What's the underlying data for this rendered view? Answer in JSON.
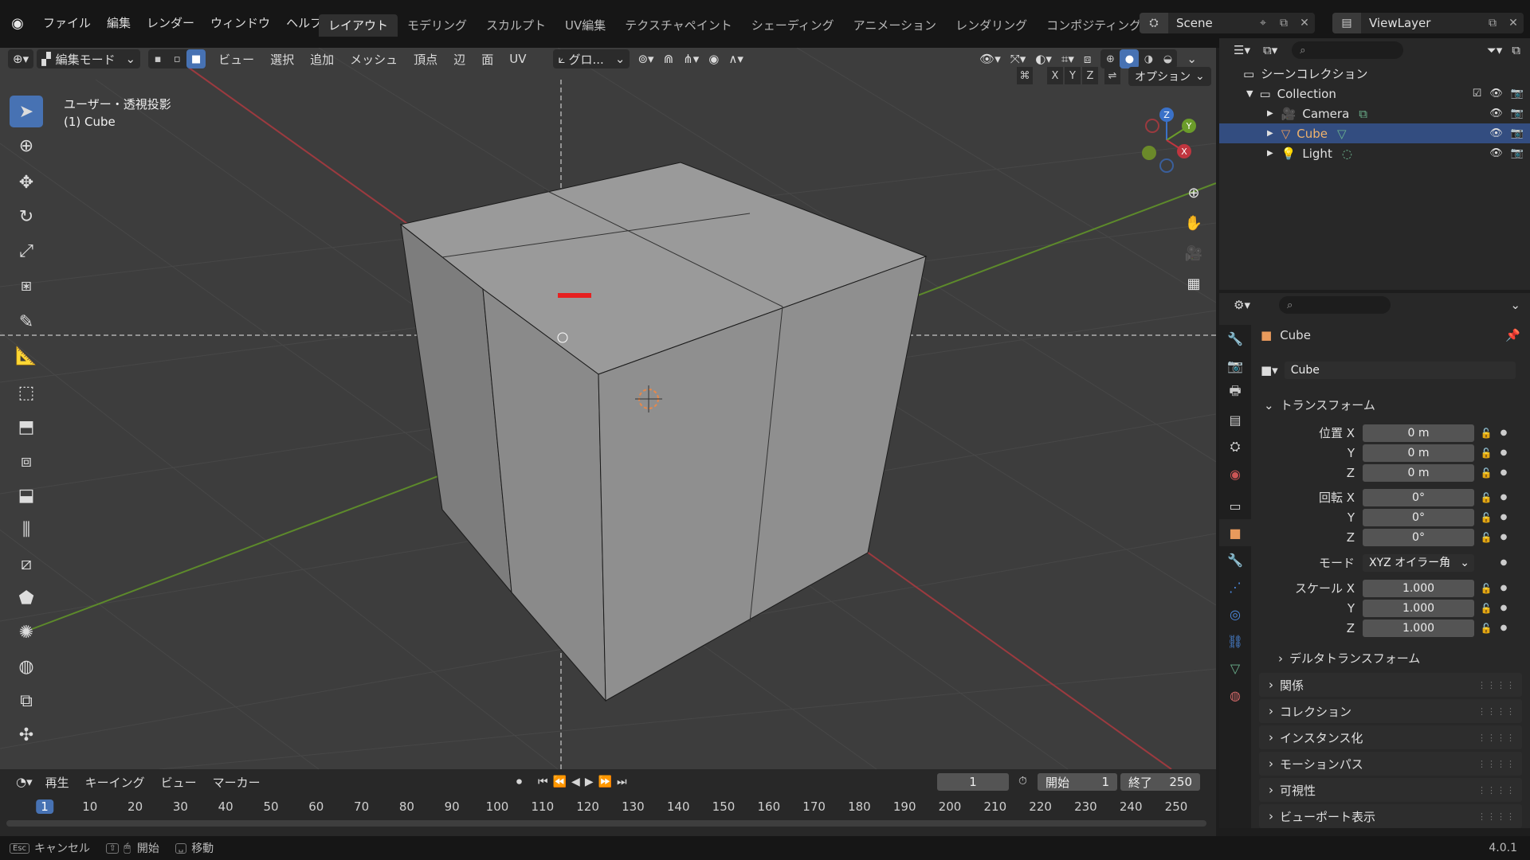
{
  "menu": {
    "items": [
      "ファイル",
      "編集",
      "レンダー",
      "ウィンドウ",
      "ヘルプ"
    ]
  },
  "workspace_tabs": [
    "レイアウト",
    "モデリング",
    "スカルプト",
    "UV編集",
    "テクスチャペイント",
    "シェーディング",
    "アニメーション",
    "レンダリング",
    "コンポジティング"
  ],
  "scene": {
    "name": "Scene"
  },
  "view_layer": {
    "name": "ViewLayer"
  },
  "viewport": {
    "mode": "編集モード",
    "menus": [
      "ビュー",
      "選択",
      "追加",
      "メッシュ",
      "頂点",
      "辺",
      "面",
      "UV"
    ],
    "orientation": "グロ...",
    "axes": [
      "X",
      "Y",
      "Z"
    ],
    "options_label": "オプション",
    "view_title": "ユーザー・透視投影",
    "object_label": "(1) Cube",
    "gizmo": {
      "x": "X",
      "y": "Y",
      "z": "Z"
    }
  },
  "outliner": {
    "root": "シーンコレクション",
    "collection": "Collection",
    "items": [
      {
        "name": "Camera",
        "icon": "camera-icon",
        "color": "#e89a5c"
      },
      {
        "name": "Cube",
        "icon": "mesh-icon",
        "color": "#e89a5c"
      },
      {
        "name": "Light",
        "icon": "light-icon",
        "color": "#e89a5c"
      }
    ]
  },
  "properties": {
    "object_name": "Cube",
    "data_name": "Cube",
    "transform_label": "トランスフォーム",
    "location_label": "位置 X",
    "rotation_label": "回転 X",
    "scale_label": "スケール X",
    "mode_label": "モード",
    "location": [
      "0 m",
      "0 m",
      "0 m"
    ],
    "rotation": [
      "0°",
      "0°",
      "0°"
    ],
    "rotation_mode": "XYZ オイラー角",
    "scale": [
      "1.000",
      "1.000",
      "1.000"
    ],
    "axis_y": "Y",
    "axis_z": "Z",
    "delta_transform": "デルタトランスフォーム",
    "panels": [
      "関係",
      "コレクション",
      "インスタンス化",
      "モーションパス",
      "可視性",
      "ビューポート表示"
    ]
  },
  "timeline": {
    "menus": [
      "再生",
      "キーイング",
      "ビュー",
      "マーカー"
    ],
    "current_frame": "1",
    "start_label": "開始",
    "start": "1",
    "end_label": "終了",
    "end": "250",
    "ticks": [
      "1",
      "10",
      "20",
      "30",
      "40",
      "50",
      "60",
      "70",
      "80",
      "90",
      "100",
      "110",
      "120",
      "130",
      "140",
      "150",
      "160",
      "170",
      "180",
      "190",
      "200",
      "210",
      "220",
      "230",
      "240",
      "250"
    ]
  },
  "status_bar": {
    "esc_key": "Esc",
    "cancel": "キャンセル",
    "start": "開始",
    "move": "移動",
    "version": "4.0.1"
  },
  "colors": {
    "accent": "#4772b3",
    "x_axis": "#c0353f",
    "y_axis": "#6b9c2a",
    "z_axis": "#3a71c8"
  }
}
